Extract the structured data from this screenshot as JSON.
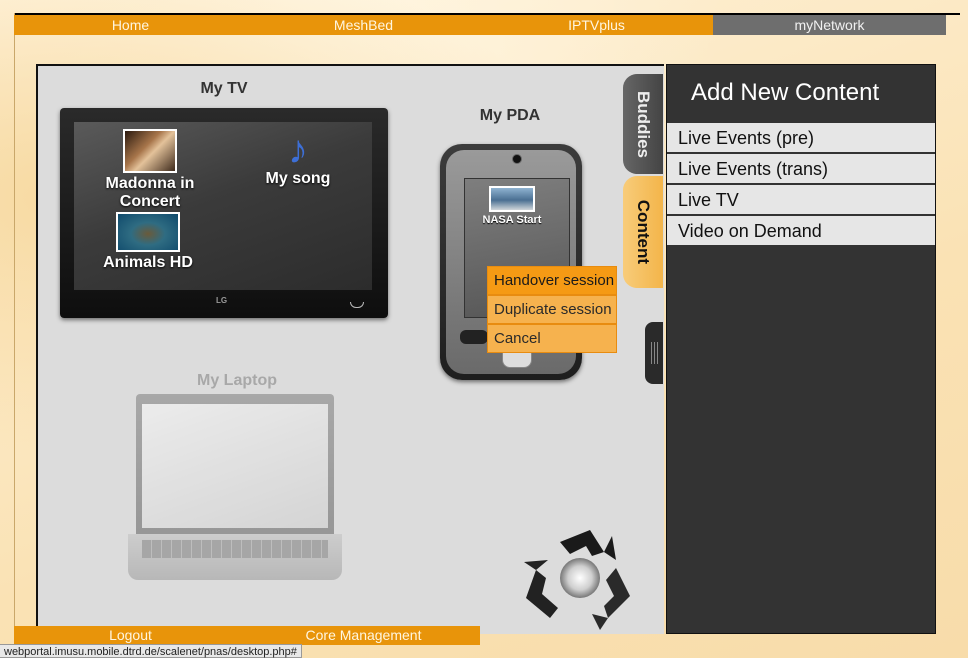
{
  "top_nav": {
    "tabs": [
      {
        "label": "Home"
      },
      {
        "label": "MeshBed"
      },
      {
        "label": "IPTVplus"
      },
      {
        "label": "myNetwork"
      }
    ]
  },
  "devices": {
    "tv": {
      "title": "My TV",
      "items": [
        {
          "label": "Madonna in Concert"
        },
        {
          "label": "My song"
        },
        {
          "label": "Animals HD"
        }
      ],
      "logo": "LG"
    },
    "pda": {
      "title": "My PDA",
      "item_label": "NASA Start"
    },
    "laptop": {
      "title": "My Laptop"
    }
  },
  "context_menu": {
    "items": [
      {
        "label": "Handover session"
      },
      {
        "label": "Duplicate session"
      },
      {
        "label": "Cancel"
      }
    ]
  },
  "side_tabs": {
    "buddies": "Buddies",
    "content": "Content"
  },
  "panel": {
    "title": "Add New Content",
    "items": [
      {
        "label": "Live Events (pre)"
      },
      {
        "label": "Live Events (trans)"
      },
      {
        "label": "Live TV"
      },
      {
        "label": "Video on Demand"
      }
    ]
  },
  "bottom_nav": {
    "tabs": [
      {
        "label": "Logout"
      },
      {
        "label": "Core Management"
      }
    ]
  },
  "status_bar": {
    "url": "webportal.imusu.mobile.dtrd.de/scalenet/pnas/desktop.php#"
  },
  "colors": {
    "accent_orange": "#e8940a",
    "active_tab": "#6e6e6e",
    "panel_bg": "#333333",
    "menu_orange": "#f6b24e"
  }
}
